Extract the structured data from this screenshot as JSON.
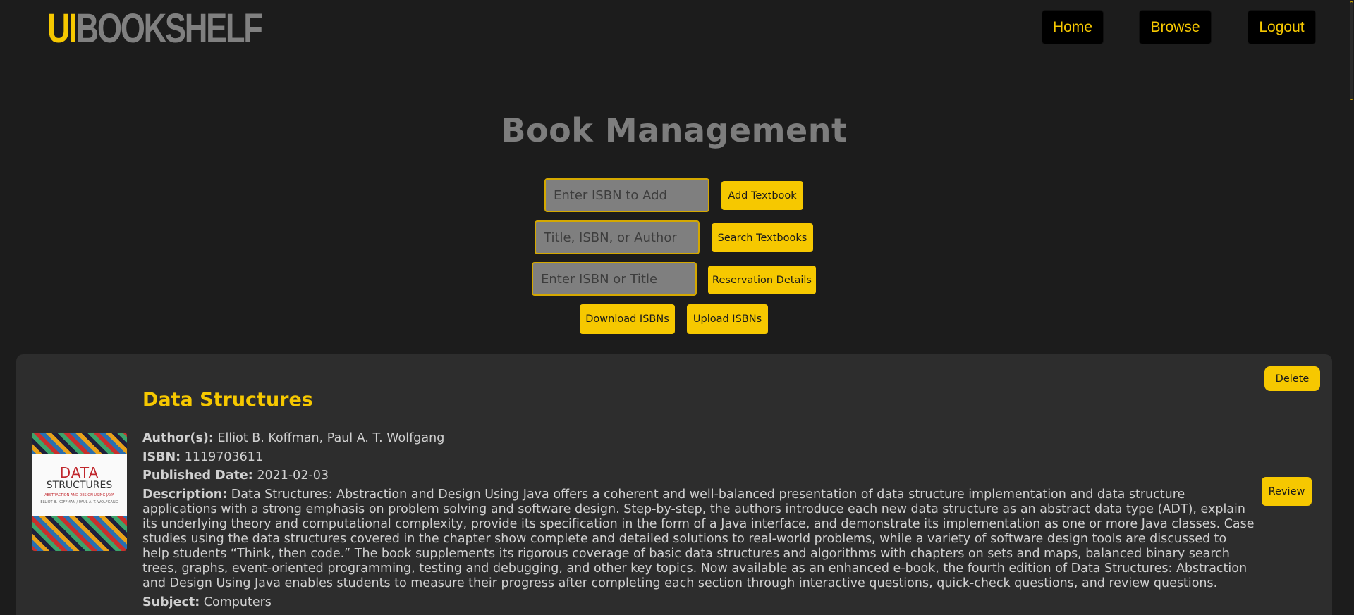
{
  "header": {
    "logo_ui": "UI",
    "logo_rest": "BOOKSHELF",
    "nav": {
      "home": "Home",
      "browse": "Browse",
      "logout": "Logout"
    }
  },
  "main": {
    "title": "Book Management",
    "add": {
      "placeholder": "Enter ISBN to Add",
      "button": "Add Textbook"
    },
    "search": {
      "placeholder": "Title, ISBN, or Author",
      "button": "Search Textbooks"
    },
    "reservation": {
      "placeholder": "Enter ISBN or Title",
      "button": "Reservation Details"
    },
    "download_button": "Download ISBNs",
    "upload_button": "Upload ISBNs"
  },
  "book": {
    "title": "Data Structures",
    "authors_label": "Author(s):",
    "authors": "Elliot B. Koffman, Paul A. T. Wolfgang",
    "isbn_label": "ISBN:",
    "isbn": "1119703611",
    "published_label": "Published Date:",
    "published": "2021-02-03",
    "description_label": "Description:",
    "description": "Data Structures: Abstraction and Design Using Java offers a coherent and well-balanced presentation of data structure implementation and data structure applications with a strong emphasis on problem solving and software design. Step-by-step, the authors introduce each new data structure as an abstract data type (ADT), explain its underlying theory and computational complexity, provide its specification in the form of a Java interface, and demonstrate its implementation as one or more Java classes. Case studies using the data structures covered in the chapter show complete and detailed solutions to real-world problems, while a variety of software design tools are discussed to help students “Think, then code.” The book supplements its rigorous coverage of basic data structures and algorithms with chapters on sets and maps, balanced binary search trees, graphs, event-oriented programming, testing and debugging, and other key topics. Now available as an enhanced e-book, the fourth edition of Data Structures: Abstraction and Design Using Java enables students to measure their progress after completing each section through interactive questions, quick-check questions, and review questions.",
    "subject_label": "Subject:",
    "subject": "Computers",
    "delete_button": "Delete",
    "review_button": "Review",
    "cover": {
      "line1": "DATA",
      "line2": "STRUCTURES",
      "line3": "ABSTRACTION AND DESIGN USING JAVA",
      "line4": "ELLIOT B. KOFFMAN / PAUL A. T. WOLFGANG"
    }
  },
  "colors": {
    "accent": "#f6c800",
    "background": "#1c1c1c",
    "card": "#2d2d2d"
  }
}
